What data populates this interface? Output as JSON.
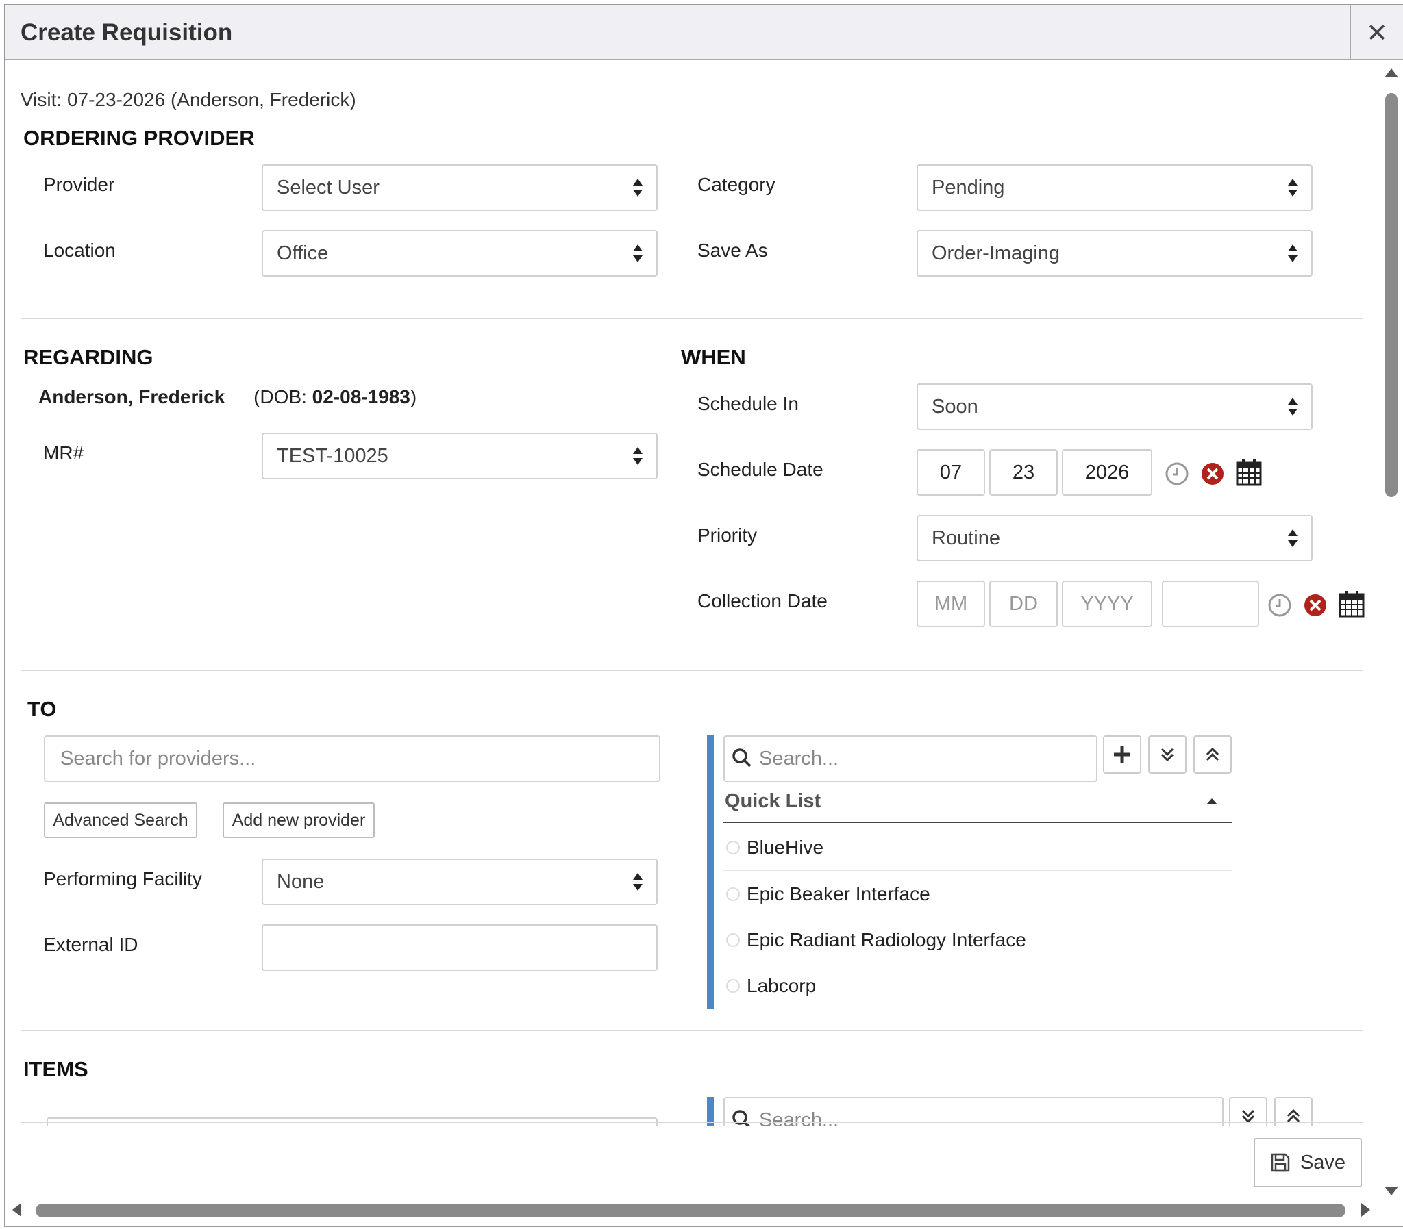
{
  "dialog": {
    "title": "Create Requisition",
    "close_label": "✕"
  },
  "visit": "Visit: 07-23-2026 (Anderson, Frederick)",
  "ordering_provider": {
    "heading": "ORDERING PROVIDER",
    "provider_label": "Provider",
    "provider_value": "Select User",
    "location_label": "Location",
    "location_value": "Office",
    "category_label": "Category",
    "category_value": "Pending",
    "save_as_label": "Save As",
    "save_as_value": "Order-Imaging"
  },
  "regarding": {
    "heading": "REGARDING",
    "patient_name": "Anderson, Frederick",
    "dob_prefix": "(DOB: ",
    "dob": "02-08-1983",
    "dob_suffix": ")",
    "mr_label": "MR#",
    "mr_value": "TEST-10025"
  },
  "when": {
    "heading": "WHEN",
    "schedule_in_label": "Schedule In",
    "schedule_in_value": "Soon",
    "schedule_date_label": "Schedule Date",
    "schedule_month": "07",
    "schedule_day": "23",
    "schedule_year": "2026",
    "priority_label": "Priority",
    "priority_value": "Routine",
    "collection_date_label": "Collection Date",
    "collection_month_placeholder": "MM",
    "collection_day_placeholder": "DD",
    "collection_year_placeholder": "YYYY",
    "collection_time": ""
  },
  "to": {
    "heading": "TO",
    "search_placeholder": "Search for providers...",
    "advanced_search": "Advanced Search",
    "add_provider": "Add new provider",
    "performing_facility_label": "Performing Facility",
    "performing_facility_value": "None",
    "external_id_label": "External ID",
    "external_id_value": "",
    "quick_search_placeholder": "Search...",
    "quick_list_title": "Quick List",
    "quick_list": [
      "BlueHive",
      "Epic Beaker Interface",
      "Epic Radiant Radiology Interface",
      "Labcorp"
    ]
  },
  "items": {
    "heading": "ITEMS",
    "search_placeholder": "Search..."
  },
  "footer": {
    "save_label": "Save"
  }
}
